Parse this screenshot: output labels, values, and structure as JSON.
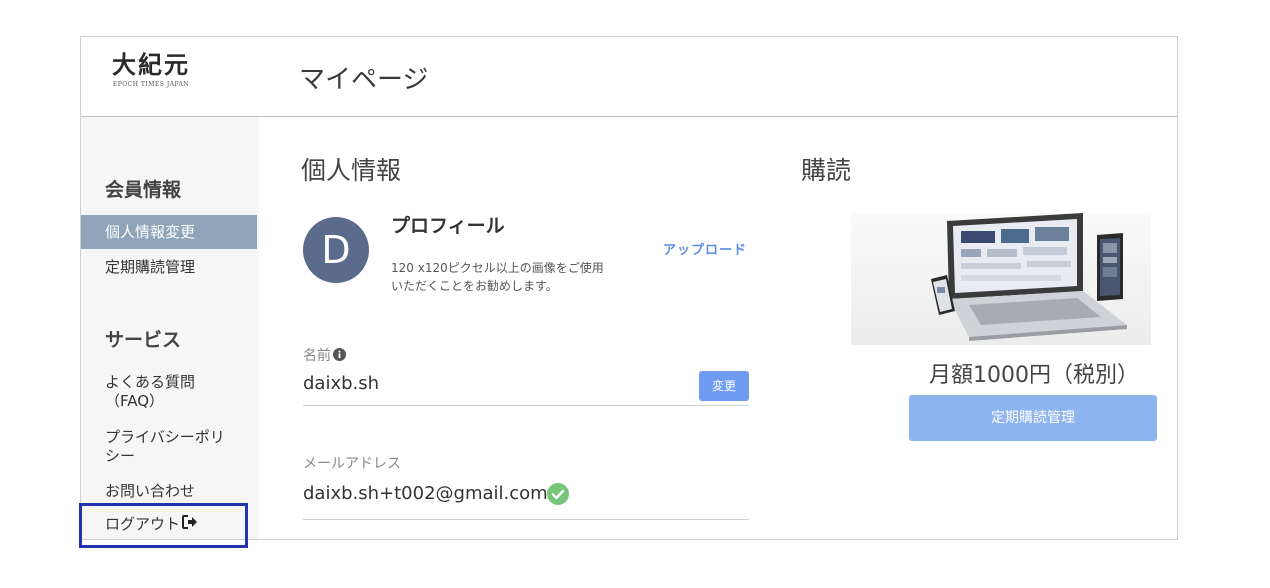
{
  "header": {
    "logo_text": "大紀元",
    "logo_sub": "EPOCH TIMES JAPAN",
    "page_title": "マイページ"
  },
  "sidebar": {
    "member_heading": "会員情報",
    "member_items": [
      {
        "label": "個人情報変更",
        "active": true
      },
      {
        "label": "定期購読管理",
        "active": false
      }
    ],
    "service_heading": "サービス",
    "service_items": [
      {
        "label_line1": "よくある質問",
        "label_line2": "（FAQ）"
      },
      {
        "label_line1": "プライバシーポリ",
        "label_line2": "シー"
      },
      {
        "label_line1": "お問い合わせ",
        "label_line2": ""
      },
      {
        "label_line1": "ログアウト",
        "label_line2": ""
      }
    ]
  },
  "personal": {
    "heading": "個人情報",
    "avatar_letter": "D",
    "profile_title": "プロフィール",
    "profile_note_1": "120 x120ピクセル以上の画像をご使用",
    "profile_note_2": "いただくことをお勧めします。",
    "upload_label": "アップロード",
    "name_label": "名前",
    "name_value": "daixb.sh",
    "change_label": "変更",
    "email_label": "メールアドレス",
    "email_value": "daixb.sh+t002@gmail.com"
  },
  "subscription": {
    "heading": "購読",
    "price": "月額1000円（税別）",
    "manage_button": "定期購読管理"
  },
  "colors": {
    "sidebar_active": "#8fa3b9",
    "avatar": "#5b6b8b",
    "link_blue": "#5b8fe6",
    "button_blue": "#8eb3f1",
    "verified_green": "#77c77a",
    "highlight": "#2532b0"
  },
  "icons": [
    "info-icon",
    "check-circle-icon",
    "logout-icon"
  ]
}
